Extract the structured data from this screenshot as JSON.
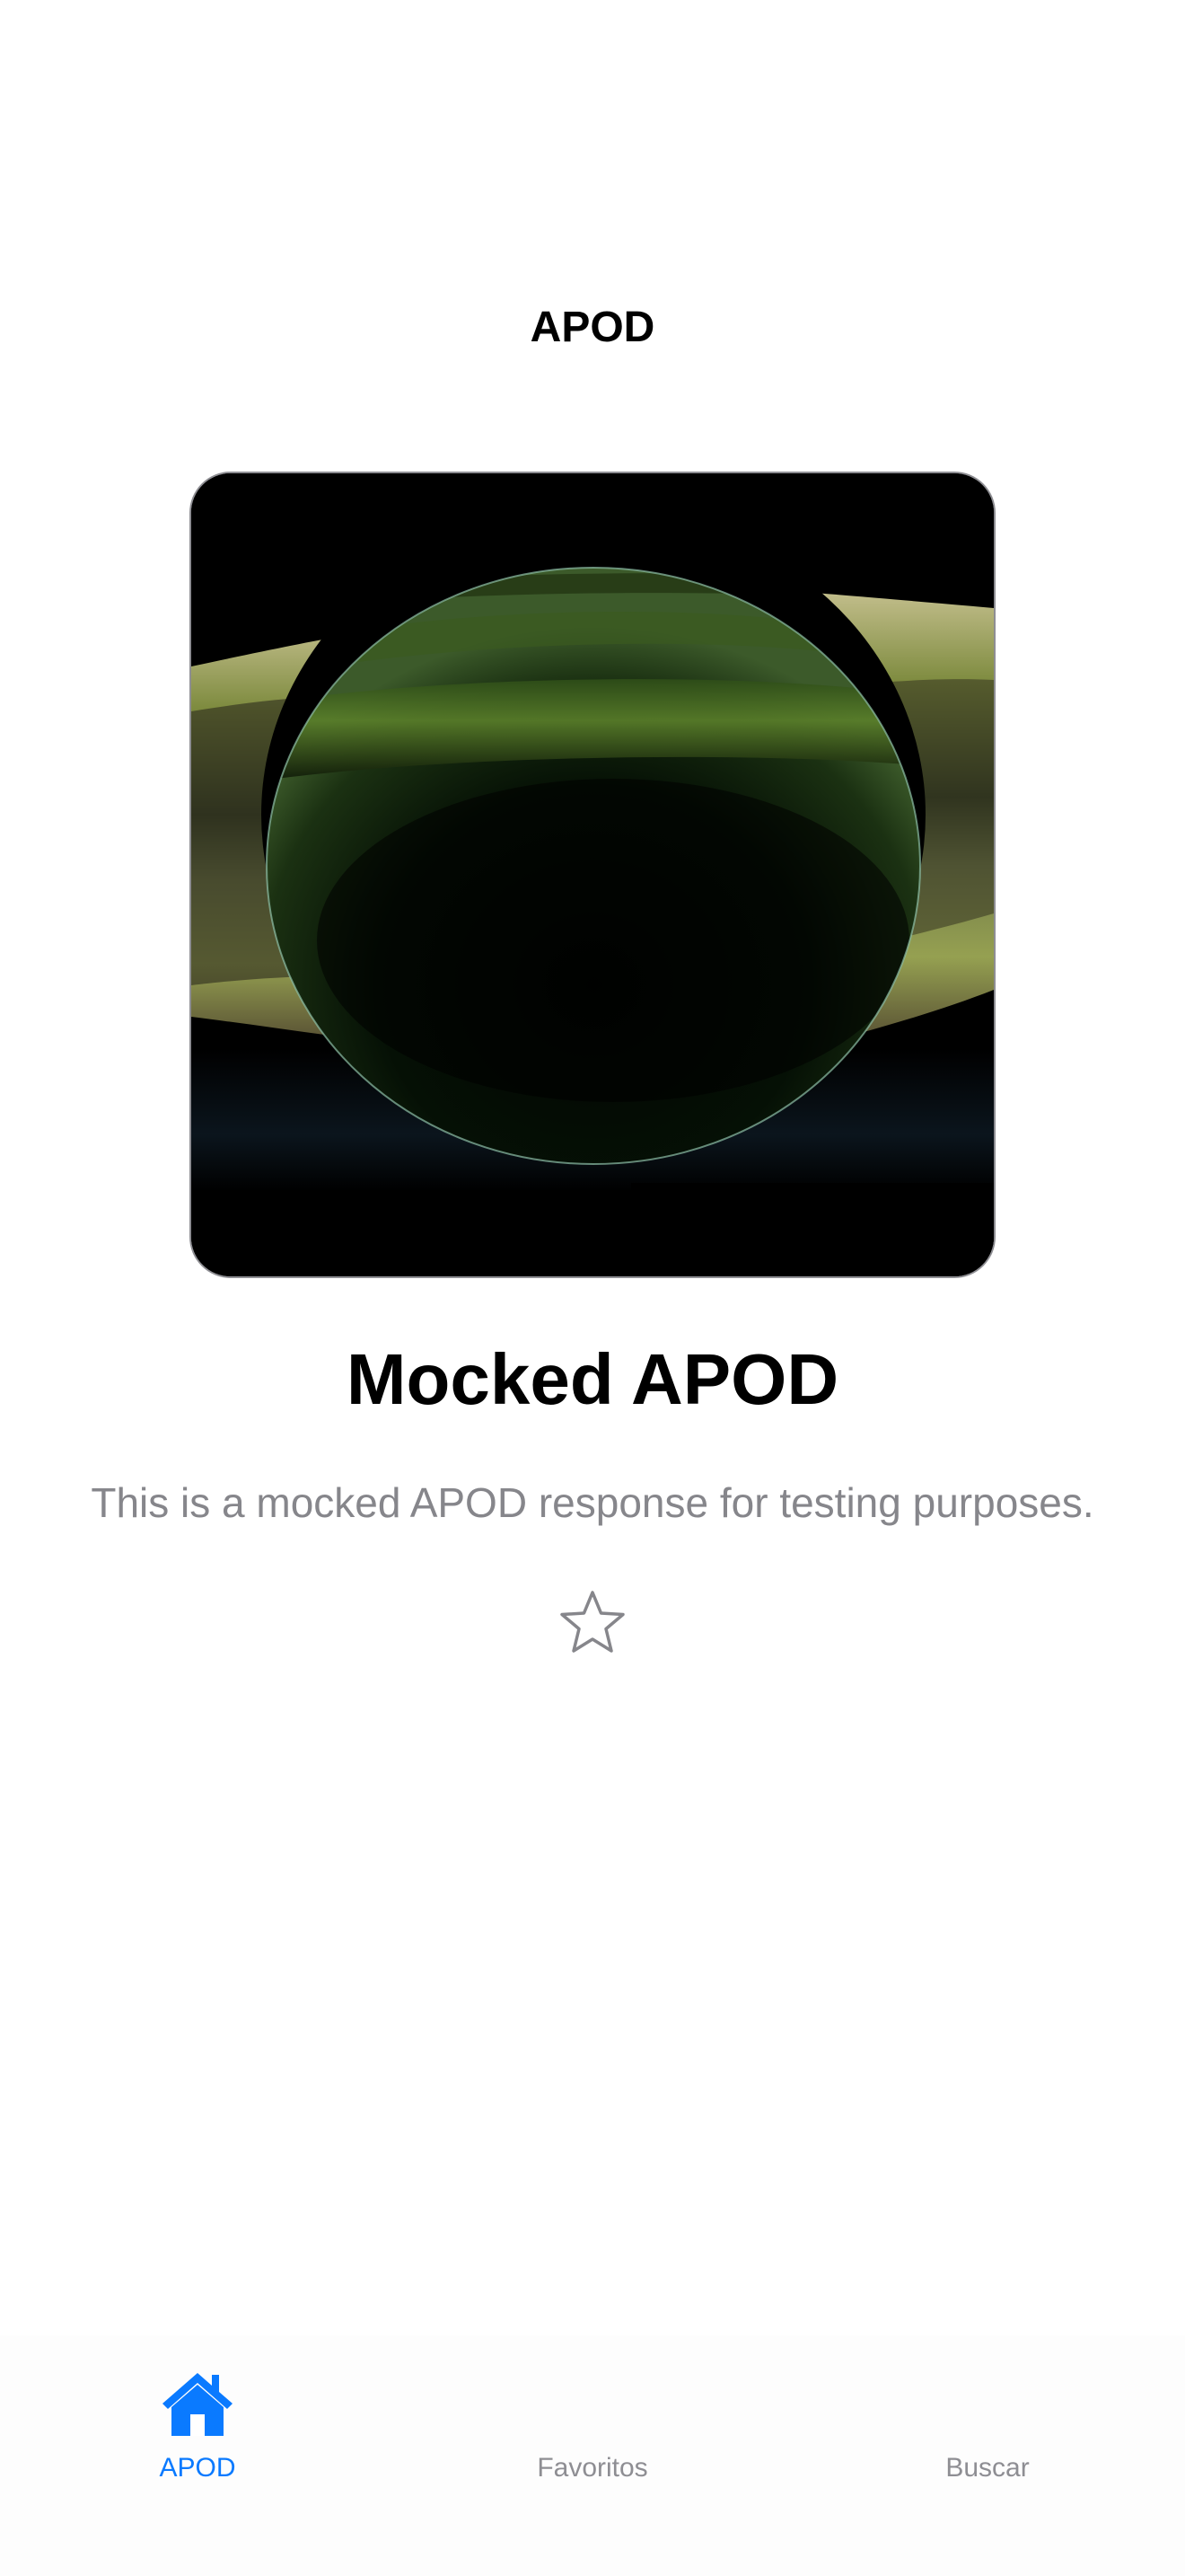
{
  "nav": {
    "title": "APOD"
  },
  "apod": {
    "image_subject": "saturn-backlit-rings",
    "title": "Mocked APOD",
    "explanation": "This is a mocked APOD response for testing purposes.",
    "favorite_icon": "star-outline-icon",
    "is_favorite": false
  },
  "tabs": [
    {
      "label": "APOD",
      "icon": "house-icon",
      "active": true
    },
    {
      "label": "Favoritos",
      "icon": "",
      "active": false
    },
    {
      "label": "Buscar",
      "icon": "",
      "active": false
    }
  ],
  "colors": {
    "accent": "#0a7aff",
    "secondary_text": "#86868b",
    "inactive_tab": "#8e8e93",
    "background": "#ffffff"
  }
}
